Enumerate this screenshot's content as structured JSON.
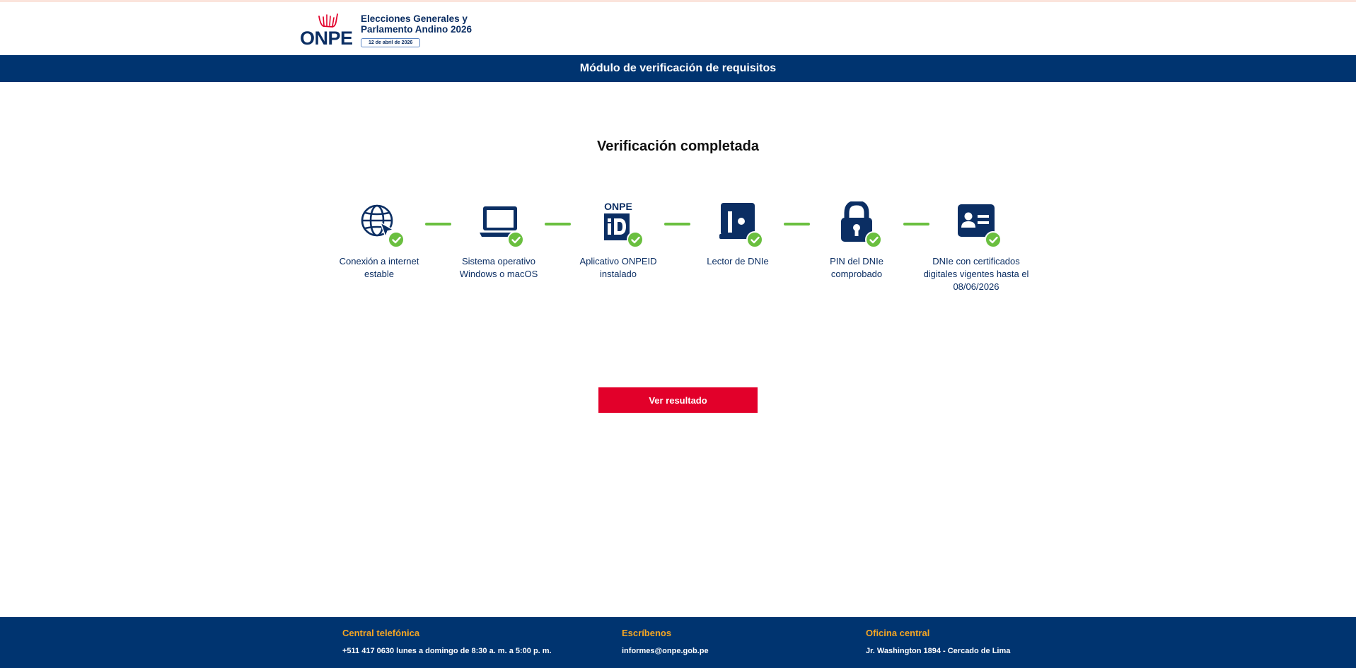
{
  "header": {
    "logo_text": "ONPE",
    "brand_title": "Elecciones Generales y Parlamento Andino 2026",
    "brand_date": "12 de abril de 2026"
  },
  "title_bar": {
    "title": "Módulo de verificación de requisitos"
  },
  "status": {
    "heading": "Verificación completada"
  },
  "steps": [
    {
      "label": "Conexión a internet estable",
      "icon": "globe-cursor-icon",
      "completed": true
    },
    {
      "label": "Sistema operativo Windows o macOS",
      "icon": "laptop-icon",
      "completed": true
    },
    {
      "label": "Aplicativo ONPEID instalado",
      "icon": "onpe-id-icon",
      "icon_text": "ONPE",
      "completed": true
    },
    {
      "label": "Lector de DNIe",
      "icon": "card-reader-icon",
      "completed": true
    },
    {
      "label": "PIN del DNIe comprobado",
      "icon": "padlock-icon",
      "completed": true
    },
    {
      "label": "DNIe con certificados digitales vigentes hasta el 08/06/2026",
      "icon": "id-card-icon",
      "completed": true
    }
  ],
  "actions": {
    "result_button": "Ver resultado"
  },
  "footer": {
    "phone": {
      "title": "Central telefónica",
      "text": "+511 417 0630 lunes a domingo de 8:30 a. m. a 5:00 p. m."
    },
    "email": {
      "title": "Escríbenos",
      "text": "informes@onpe.gob.pe"
    },
    "office": {
      "title": "Oficina central",
      "text": "Jr. Washington 1894 - Cercado de Lima"
    }
  },
  "colors": {
    "primary_blue": "#003470",
    "accent_red": "#e2002a",
    "success_green": "#6abf3f",
    "footer_heading": "#f5a623"
  }
}
